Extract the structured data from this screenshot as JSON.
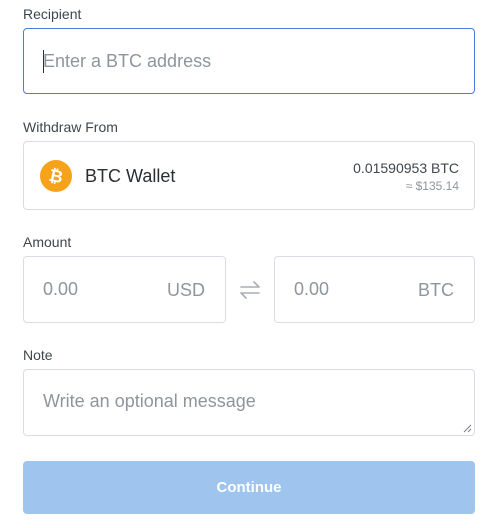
{
  "recipient": {
    "label": "Recipient",
    "placeholder": "Enter a BTC address",
    "value": ""
  },
  "withdraw": {
    "label": "Withdraw From",
    "wallet_name": "BTC Wallet",
    "balance": "0.01590953 BTC",
    "fiat_value": "≈ $135.14",
    "icon": "bitcoin-icon",
    "icon_color": "#f7a21b"
  },
  "amount": {
    "label": "Amount",
    "usd_placeholder": "0.00",
    "usd_unit": "USD",
    "btc_placeholder": "0.00",
    "btc_unit": "BTC",
    "swap_icon": "swap-arrows-icon"
  },
  "note": {
    "label": "Note",
    "placeholder": "Write an optional message"
  },
  "continue_button": {
    "label": "Continue",
    "color": "#9fc5ee"
  },
  "colors": {
    "focus_border": "#4b7fd6",
    "border": "#d9dde3",
    "placeholder": "#8f959c"
  }
}
